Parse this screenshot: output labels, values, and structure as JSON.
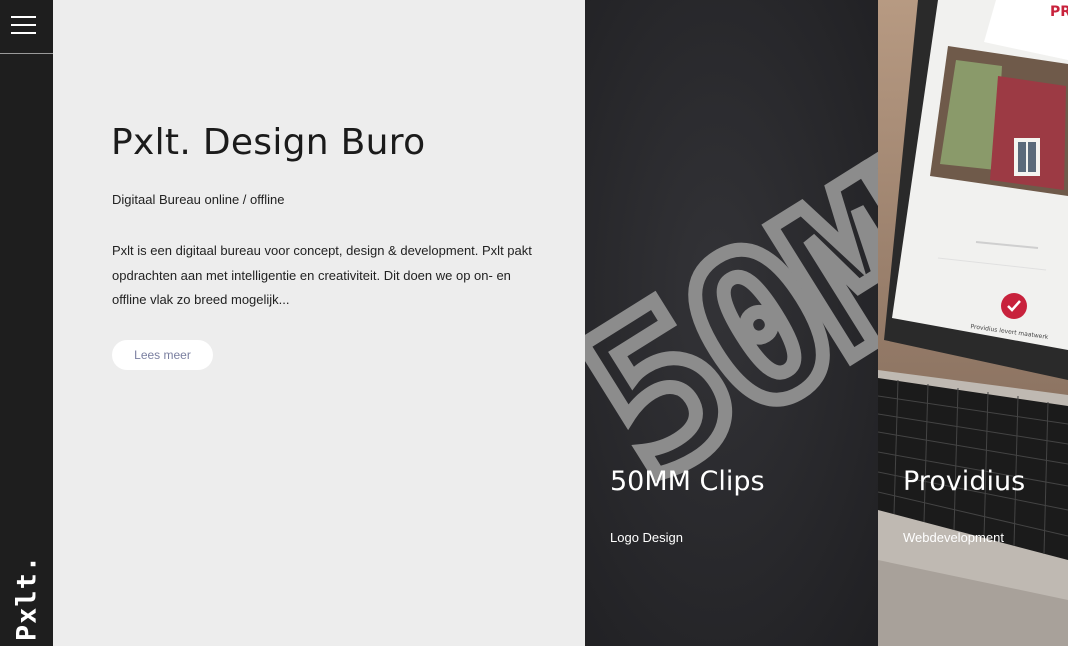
{
  "brand": {
    "logo_text": "Pxlt."
  },
  "intro": {
    "title": "Pxlt. Design Buro",
    "subtitle": "Digitaal Bureau online / offline",
    "body_lines": [
      "Pxlt is een digitaal bureau voor concept, design & development. Pxlt pakt",
      "opdrachten aan met intelligentie en creativiteit. Dit doen we op on- en",
      "offline vlak zo breed mogelijk..."
    ],
    "more_button": "Lees meer"
  },
  "projects": [
    {
      "title": "50MM Clips",
      "category": "Logo Design",
      "art_text": "50MM"
    },
    {
      "title": "Providius",
      "category": "Webdevelopment",
      "screen_text": "Providius levert maatwerk",
      "screen_logo": "PR"
    }
  ],
  "colors": {
    "sidebar": "#1e1e1e",
    "background": "#ededed",
    "card_dark": "#2a2a2d",
    "check_red": "#c8223c",
    "button_text": "#7a7fa0"
  },
  "icons": {
    "menu": "hamburger-icon",
    "check": "check-icon"
  }
}
